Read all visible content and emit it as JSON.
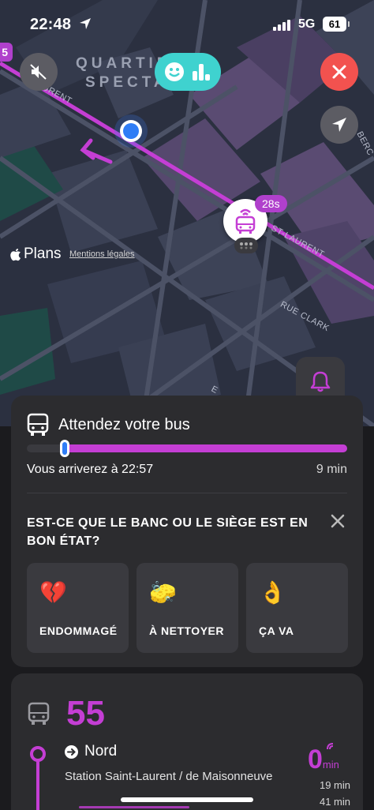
{
  "status_bar": {
    "time": "22:48",
    "network": "5G",
    "battery": "61"
  },
  "map": {
    "edge_badge": "5",
    "district_label_line1": "QUARTIE",
    "district_label_line2": "SPECTA",
    "streets": [
      "LAURENT",
      "BERC",
      "ST-LAURENT",
      "RUE CLARK",
      "E"
    ],
    "bus_eta": "28s",
    "maps_brand": "Plans",
    "legal_link": "Mentions légales"
  },
  "wait": {
    "title": "Attendez votre bus",
    "progress": 0.03,
    "arrive_text": "Vous arriverez à 22:57",
    "duration": "9 min"
  },
  "survey": {
    "question": "EST-CE QUE LE BANC OU LE SIÈGE EST EN BON ÉTAT?",
    "options": [
      {
        "emoji": "💔",
        "label": "ENDOMMAGÉ"
      },
      {
        "emoji": "🧽",
        "label": "À NETTOYER"
      },
      {
        "emoji": "👌",
        "label": "ÇA VA"
      }
    ]
  },
  "route": {
    "number": "55",
    "direction": "Nord",
    "stop": "Station Saint-Laurent / de Maisonneuve",
    "next_value": "0",
    "next_unit": "min",
    "later_times": [
      "19 min",
      "41 min"
    ]
  },
  "colors": {
    "accent": "#c43ed4",
    "close": "#f2524f",
    "feedback": "#3fd2cf",
    "user_dot": "#2f7df6"
  }
}
